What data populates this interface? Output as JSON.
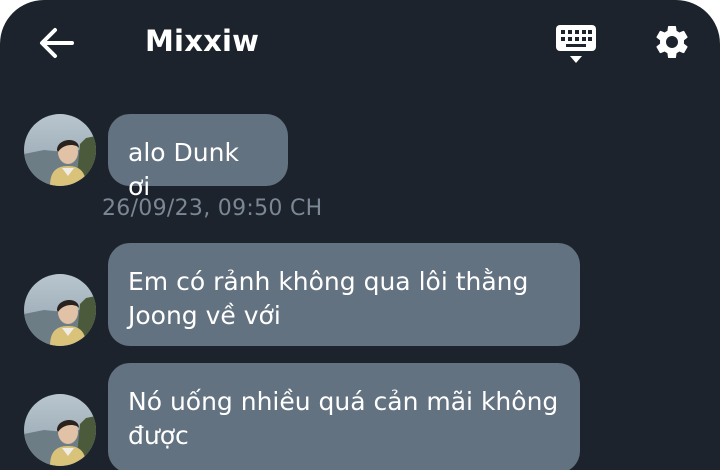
{
  "header": {
    "title": "Mixxiw",
    "back_icon": "arrow-left-icon",
    "keyboard_icon": "keyboard-hide-icon",
    "settings_icon": "gear-icon"
  },
  "colors": {
    "background": "#1c232c",
    "bubble": "#637281",
    "timestamp": "#7b8794",
    "text": "#ffffff"
  },
  "messages": [
    {
      "text": "alo Dunk ơi"
    },
    {
      "text": "Em có rảnh không qua lôi thằng Joong về với"
    },
    {
      "text": "Nó uống nhiều quá cản mãi không được"
    }
  ],
  "timestamp": "26/09/23, 09:50 CH"
}
